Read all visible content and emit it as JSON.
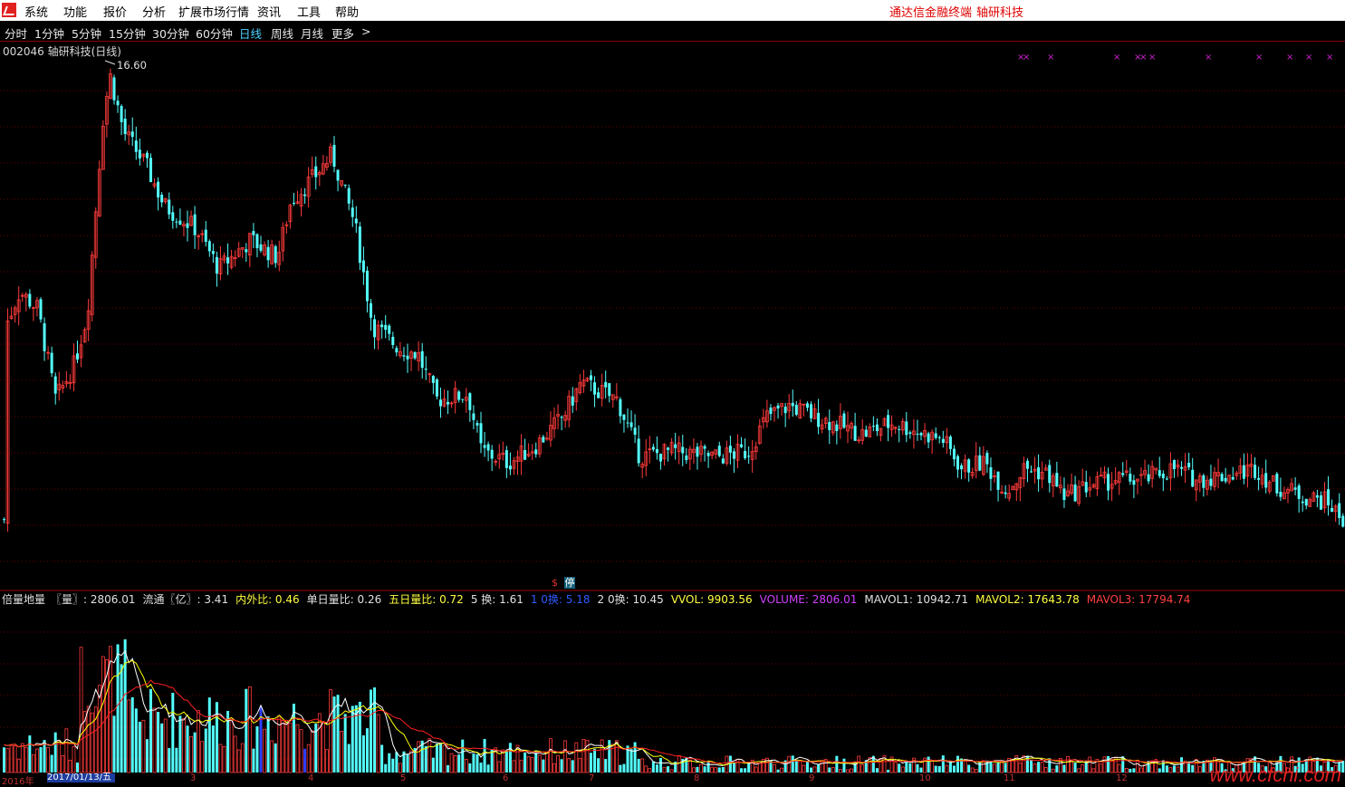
{
  "menu": {
    "items": [
      "系统",
      "功能",
      "报价",
      "分析",
      "扩展市场行情",
      "资讯",
      "工具",
      "帮助"
    ],
    "brand_left": "通达信金融终端",
    "brand_right": "轴研科技"
  },
  "periods": {
    "items": [
      "分时",
      "1分钟",
      "5分钟",
      "15分钟",
      "30分钟",
      "60分钟",
      "日线",
      "周线",
      "月线",
      "更多"
    ],
    "more_arrow": ">",
    "selected": "日线"
  },
  "chart": {
    "title": "002046 轴研科技(日线)",
    "max_label": "16.60",
    "stop_mark": "$",
    "stop_label": "停",
    "colors": {
      "up": "#ff3b3b",
      "down": "#54ffff",
      "bg": "#000000",
      "grid": "#6a0000",
      "ma1": "#ffffff",
      "ma2": "#ffff00",
      "ma3": "#ff2020"
    }
  },
  "indicator": {
    "items": [
      {
        "text": "倍量地量",
        "color": "#e0e0e0"
      },
      {
        "text": "〖量〗: 2806.01",
        "color": "#e0e0e0"
      },
      {
        "text": "流通〖亿〗: 3.41",
        "color": "#e0e0e0"
      },
      {
        "text": "内外比: 0.46",
        "color": "#ffff40"
      },
      {
        "text": "单日量比: 0.26",
        "color": "#e0e0e0"
      },
      {
        "text": "五日量比: 0.72",
        "color": "#ffff40"
      },
      {
        "text": "5 换: 1.61",
        "color": "#e0e0e0"
      },
      {
        "text": "1 0换: 5.18",
        "color": "#2f5bff"
      },
      {
        "text": "2 0换: 10.45",
        "color": "#e0e0e0"
      },
      {
        "text": "VVOL: 9903.56",
        "color": "#ffff40"
      },
      {
        "text": "VOLUME: 2806.01",
        "color": "#d040ff"
      },
      {
        "text": "MAVOL1: 10942.71",
        "color": "#e0e0e0"
      },
      {
        "text": "MAVOL2: 17643.78",
        "color": "#ffff40"
      },
      {
        "text": "MAVOL3: 17794.74",
        "color": "#ff4040"
      }
    ]
  },
  "xaxis": {
    "date_label": "2017/01/13/五",
    "labels": [
      "2016年",
      "3",
      "4",
      "5",
      "6",
      "7",
      "8",
      "9",
      "10",
      "11",
      "12"
    ]
  },
  "watermark": "www.cfchi.com",
  "chart_data": {
    "type": "candlestick",
    "title": "002046 轴研科技(日线)",
    "max_price": 16.6,
    "closes_approx": [
      12.0,
      12.4,
      12.6,
      11.2,
      10.9,
      11.5,
      12.0,
      15.6,
      16.4,
      15.8,
      15.0,
      14.6,
      14.9,
      14.2,
      13.6,
      14.0,
      13.4,
      14.0,
      13.2,
      14.2,
      14.5,
      15.3,
      14.6,
      14.0,
      12.0,
      11.7,
      11.4,
      11.7,
      11.0,
      10.8,
      10.2,
      9.9,
      10.5,
      9.8,
      9.9,
      10.9,
      10.8,
      10.4,
      10.0,
      10.8,
      10.2,
      9.9,
      10.0,
      10.6,
      10.6,
      10.1,
      10.1,
      10.4,
      10.2,
      9.9,
      9.6,
      10.1,
      9.4,
      9.6,
      9.4,
      9.7,
      9.7,
      9.6,
      9.3,
      9.5,
      9.1,
      9.0,
      9.4,
      9.6,
      9.7,
      9.5,
      9.5,
      9.6,
      9.5,
      9.2,
      8.8,
      8.6
    ],
    "volume_last": 2806.01
  },
  "marks": {
    "x_symbol": "×"
  }
}
